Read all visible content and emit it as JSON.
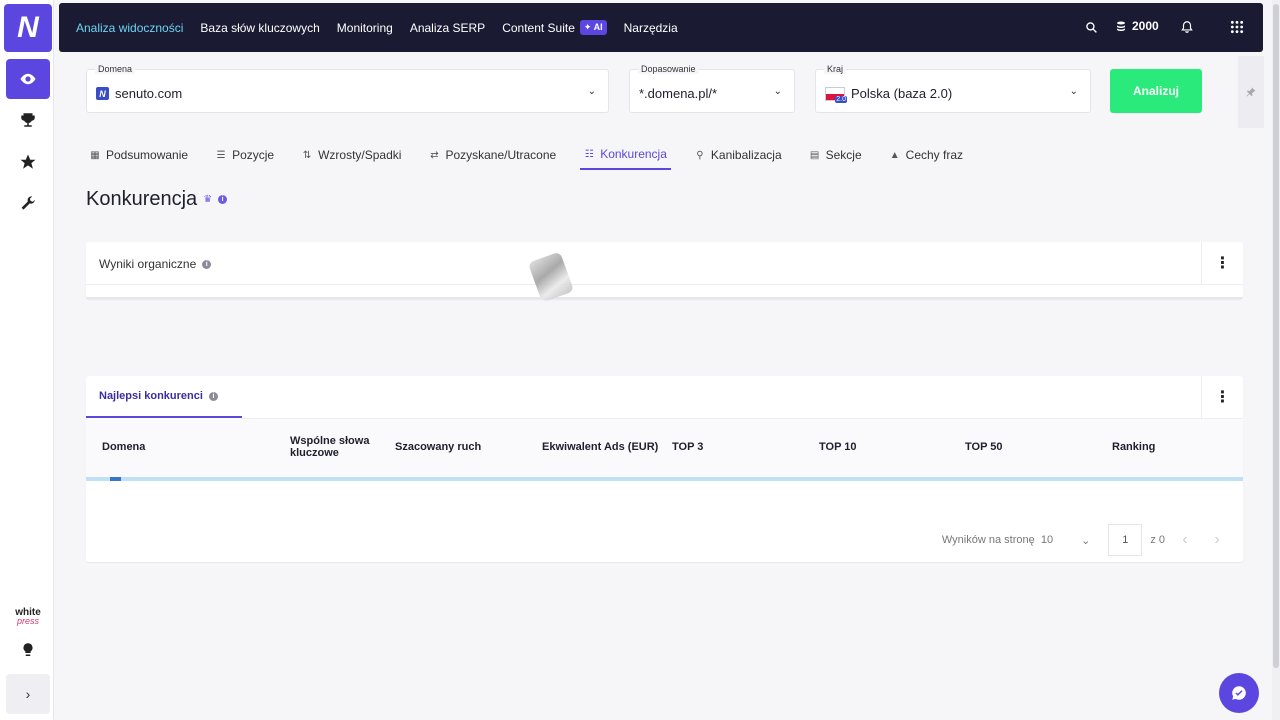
{
  "topnav": {
    "items": [
      {
        "label": "Analiza widoczności",
        "active": true
      },
      {
        "label": "Baza słów kluczowych"
      },
      {
        "label": "Monitoring"
      },
      {
        "label": "Analiza SERP"
      },
      {
        "label": "Content Suite",
        "badge": "AI"
      },
      {
        "label": "Narzędzia"
      }
    ],
    "credits": "2000"
  },
  "sidebar": {
    "logo": "N",
    "whitepress_line1": "white",
    "whitepress_line2": "press"
  },
  "search": {
    "domain_label": "Domena",
    "domain_value": "senuto.com",
    "match_label": "Dopasowanie",
    "match_value": "*.domena.pl/*",
    "country_label": "Kraj",
    "country_value": "Polska (baza 2.0)",
    "country_badge": "2.0",
    "analyze_label": "Analizuj"
  },
  "tabs": [
    {
      "label": "Podsumowanie",
      "icon": "dashboard-icon"
    },
    {
      "label": "Pozycje",
      "icon": "list-icon"
    },
    {
      "label": "Wzrosty/Spadki",
      "icon": "up-down-icon"
    },
    {
      "label": "Pozyskane/Utracone",
      "icon": "swap-icon"
    },
    {
      "label": "Konkurencja",
      "icon": "group-icon",
      "active": true
    },
    {
      "label": "Kanibalizacja",
      "icon": "person-icon"
    },
    {
      "label": "Sekcje",
      "icon": "sections-icon"
    },
    {
      "label": "Cechy fraz",
      "icon": "shapes-icon"
    }
  ],
  "page": {
    "title": "Konkurencja"
  },
  "organic": {
    "title": "Wyniki organiczne"
  },
  "competitors": {
    "tab_label": "Najlepsi konkurenci",
    "columns": {
      "domain": "Domena",
      "common_kw_1": "Wspólne słowa",
      "common_kw_2": "kluczowe",
      "traffic": "Szacowany ruch",
      "ads": "Ekwiwalent Ads (EUR)",
      "top3": "TOP 3",
      "top10": "TOP 10",
      "top50": "TOP 50",
      "ranking": "Ranking"
    },
    "pager": {
      "per_page_label": "Wyników na stronę",
      "per_page_value": "10",
      "page_value": "1",
      "of_label": "z 0"
    }
  },
  "colors": {
    "accent": "#5b47e0",
    "nav_bg": "#1a1b33",
    "nav_active": "#6fd3f2",
    "analyze": "#2bea7c"
  }
}
